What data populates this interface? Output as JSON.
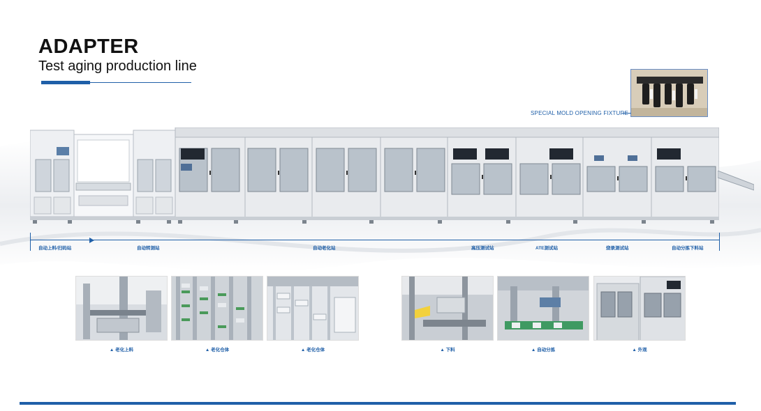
{
  "header": {
    "title": "ADAPTER",
    "subtitle": "Test aging production line"
  },
  "fixture": {
    "label": "SPECIAL MOLD OPENING FIXTURE"
  },
  "stations": [
    {
      "label": "自动上料/扫码站"
    },
    {
      "label": "自动转测站"
    },
    {
      "label": "自动老化站"
    },
    {
      "label": "高压测试站"
    },
    {
      "label": "ATE测试站"
    },
    {
      "label": "烧录测试站"
    },
    {
      "label": "自动分拣下料站"
    }
  ],
  "photos": [
    {
      "caption": "▲ 老化上料"
    },
    {
      "caption": "▲ 老化仓体"
    },
    {
      "caption": "▲ 老化仓体"
    },
    {
      "caption": "▲ 下料"
    },
    {
      "caption": "▲ 自动分拣"
    },
    {
      "caption": "▲ 外观"
    }
  ],
  "colors": {
    "accent": "#1f5fa8",
    "machine_body": "#e9ebee",
    "machine_frame": "#c9ced4"
  }
}
